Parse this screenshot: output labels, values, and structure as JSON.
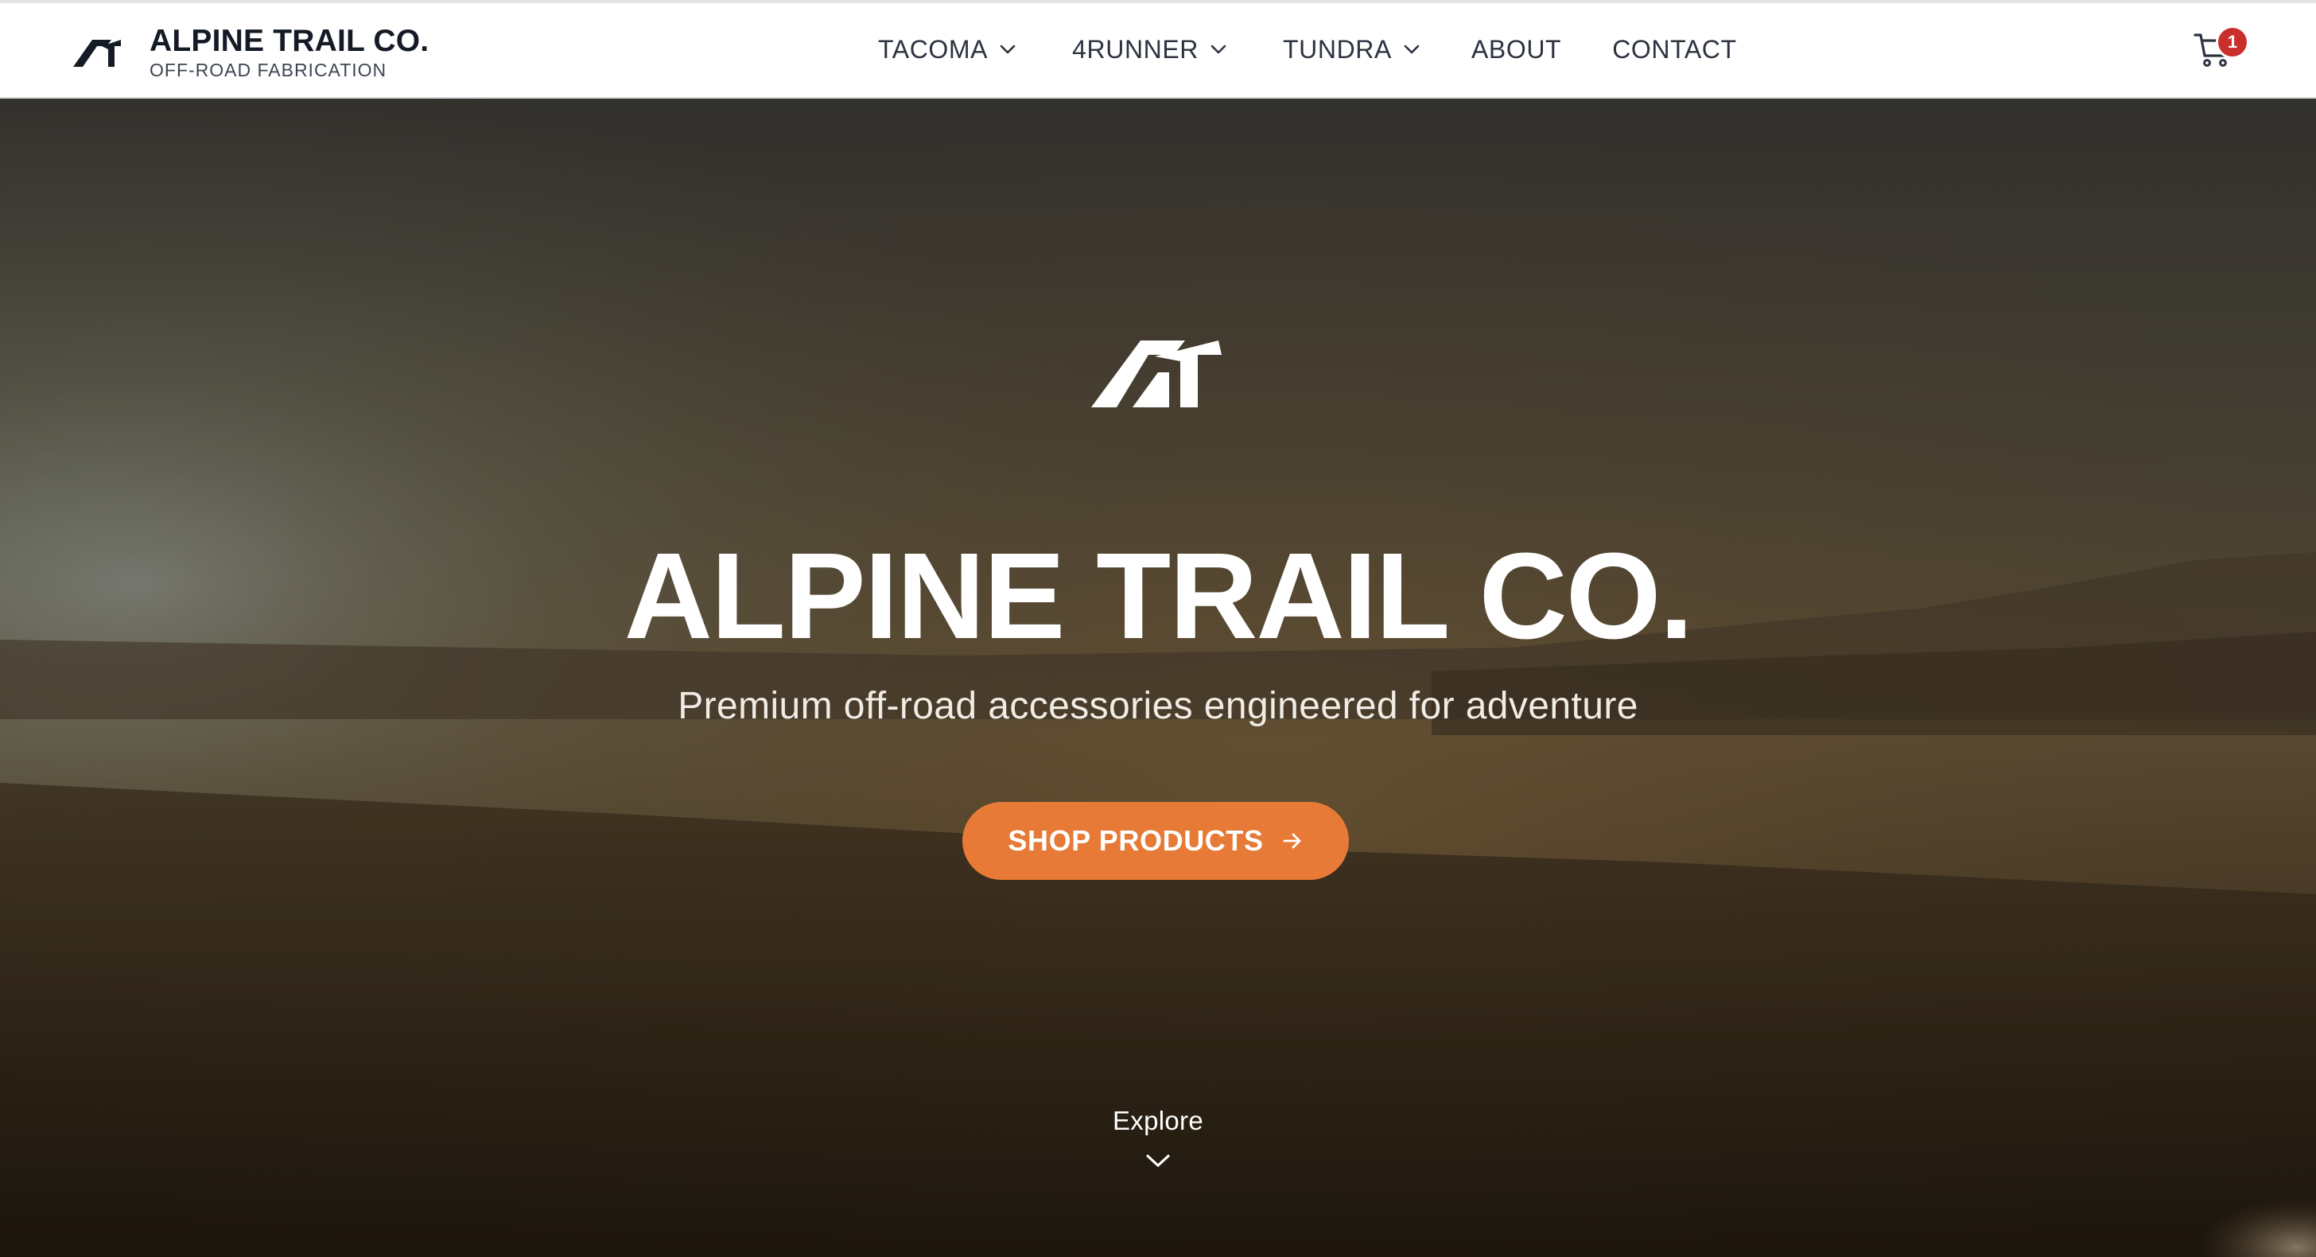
{
  "brand": {
    "name": "ALPINE TRAIL CO.",
    "tagline": "OFF-ROAD FABRICATION",
    "logo_icon": "alpine-trail-logo-icon"
  },
  "nav": {
    "items": [
      {
        "label": "TACOMA",
        "has_dropdown": true
      },
      {
        "label": "4RUNNER",
        "has_dropdown": true
      },
      {
        "label": "TUNDRA",
        "has_dropdown": true
      },
      {
        "label": "ABOUT",
        "has_dropdown": false
      },
      {
        "label": "CONTACT",
        "has_dropdown": false
      }
    ]
  },
  "cart": {
    "icon": "shopping-cart-icon",
    "count": "1",
    "badge_color": "#c9302c"
  },
  "hero": {
    "title": "ALPINE TRAIL CO.",
    "subtitle": "Premium off-road accessories engineered for adventure",
    "cta_label": "SHOP PRODUCTS",
    "cta_icon": "arrow-right-icon",
    "cta_color": "#e67a36",
    "explore_label": "Explore",
    "explore_icon": "chevron-down-icon"
  },
  "colors": {
    "text_dark": "#141a26",
    "accent": "#e67a36",
    "header_bg": "#ffffff"
  }
}
